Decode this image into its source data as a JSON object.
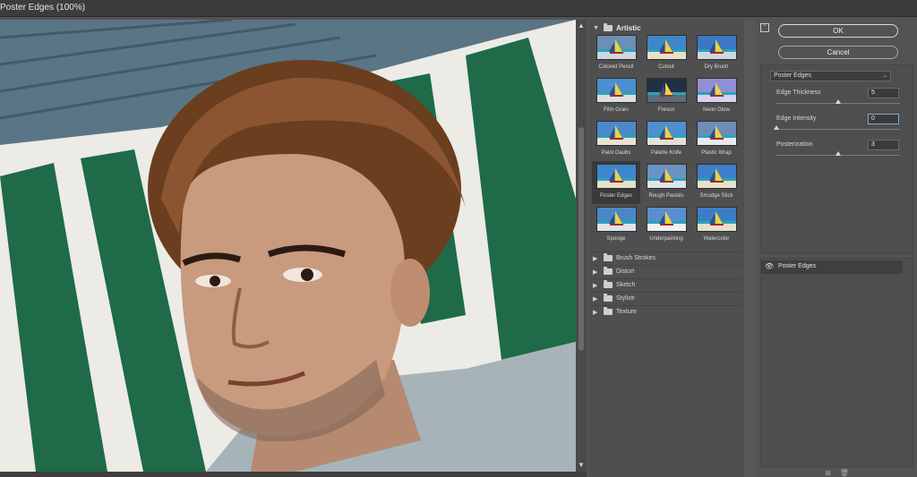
{
  "window": {
    "title": "Poster Edges (100%)"
  },
  "preview": {
    "scroll_up": "▲",
    "scroll_down": "▼"
  },
  "gallery": {
    "open_category": "Artistic",
    "filters": [
      {
        "label": "Colored Pencil",
        "selected": false
      },
      {
        "label": "Cutout",
        "selected": false
      },
      {
        "label": "Dry Brush",
        "selected": false
      },
      {
        "label": "Film Grain",
        "selected": false
      },
      {
        "label": "Fresco",
        "selected": false
      },
      {
        "label": "Neon Glow",
        "selected": false
      },
      {
        "label": "Paint Daubs",
        "selected": false
      },
      {
        "label": "Palette Knife",
        "selected": false
      },
      {
        "label": "Plastic Wrap",
        "selected": false
      },
      {
        "label": "Poster Edges",
        "selected": true
      },
      {
        "label": "Rough Pastels",
        "selected": false
      },
      {
        "label": "Smudge Stick",
        "selected": false
      },
      {
        "label": "Sponge",
        "selected": false
      },
      {
        "label": "Underpainting",
        "selected": false
      },
      {
        "label": "Watercolor",
        "selected": false
      }
    ],
    "categories": [
      "Brush Strokes",
      "Distort",
      "Sketch",
      "Stylize",
      "Texture"
    ]
  },
  "panel": {
    "ok_label": "OK",
    "cancel_label": "Cancel",
    "filter_select": "Poster Edges",
    "params": [
      {
        "label": "Edge Thickness",
        "value": "5",
        "level": 0.5
      },
      {
        "label": "Edge Intensity",
        "value": "0",
        "level": 0.0
      },
      {
        "label": "Posterization",
        "value": "3",
        "level": 0.5
      }
    ],
    "layers": [
      {
        "name": "Poster Edges"
      }
    ]
  },
  "colors": {
    "accent_focus": "#7fa7d6",
    "panel_bg": "#535353"
  }
}
